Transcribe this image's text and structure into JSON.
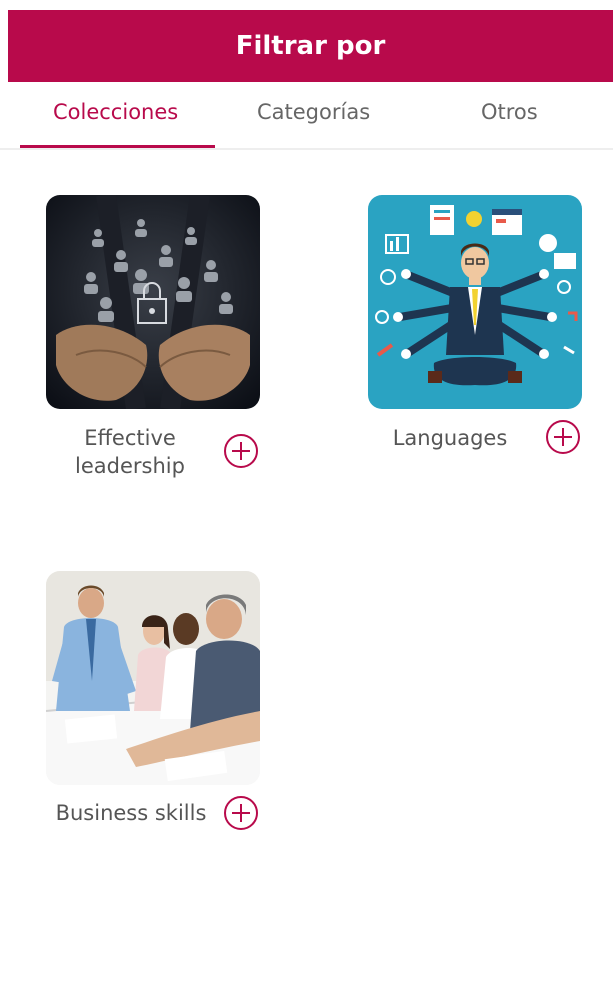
{
  "header": {
    "title": "Filtrar por"
  },
  "tabs": [
    {
      "label": "Colecciones",
      "active": true
    },
    {
      "label": "Categorías",
      "active": false
    },
    {
      "label": "Otros",
      "active": false
    }
  ],
  "collections": [
    {
      "label_line1": "Effective",
      "label_line2": "leadership",
      "image": "leadership-hands-lock-photo"
    },
    {
      "label": "Languages",
      "image": "multitasking-businessman-illustration"
    },
    {
      "label": "Business skills",
      "image": "business-meeting-photo"
    }
  ],
  "colors": {
    "brand": "#b80a4b",
    "tab_text": "#666666",
    "label_text": "#555555"
  },
  "icons": {
    "add": "plus-circle-icon"
  }
}
